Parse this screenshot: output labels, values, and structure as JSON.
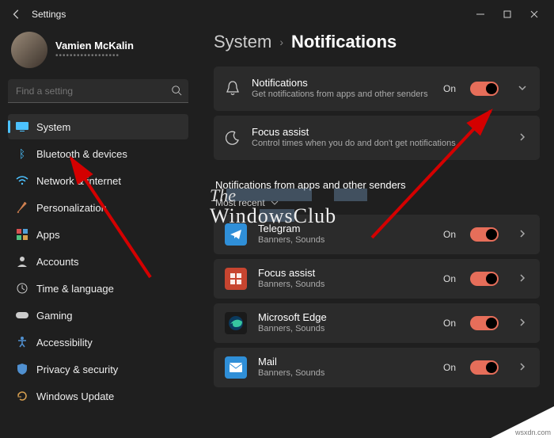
{
  "window": {
    "title": "Settings"
  },
  "user": {
    "name": "Vamien McKalin",
    "email": "••••••••••••••••••"
  },
  "search": {
    "placeholder": "Find a setting"
  },
  "sidebar": {
    "items": [
      {
        "icon": "system",
        "label": "System",
        "selected": true
      },
      {
        "icon": "bluetooth",
        "label": "Bluetooth & devices"
      },
      {
        "icon": "wifi",
        "label": "Network & internet"
      },
      {
        "icon": "brush",
        "label": "Personalization"
      },
      {
        "icon": "apps",
        "label": "Apps"
      },
      {
        "icon": "person",
        "label": "Accounts"
      },
      {
        "icon": "clock",
        "label": "Time & language"
      },
      {
        "icon": "game",
        "label": "Gaming"
      },
      {
        "icon": "access",
        "label": "Accessibility"
      },
      {
        "icon": "shield",
        "label": "Privacy & security"
      },
      {
        "icon": "update",
        "label": "Windows Update"
      }
    ]
  },
  "breadcrumb": {
    "parent": "System",
    "sep": "›",
    "current": "Notifications"
  },
  "cards": {
    "notifications": {
      "title": "Notifications",
      "sub": "Get notifications from apps and other senders",
      "state": "On"
    },
    "focus": {
      "title": "Focus assist",
      "sub": "Control times when you do and don't get notifications"
    }
  },
  "appsSection": {
    "title": "Notifications from apps and other senders",
    "sort": "Most recent"
  },
  "apps": [
    {
      "name": "Telegram",
      "sub": "Banners, Sounds",
      "state": "On",
      "iconClass": "ic-telegram"
    },
    {
      "name": "Focus assist",
      "sub": "Banners, Sounds",
      "state": "On",
      "iconClass": "ic-focus"
    },
    {
      "name": "Microsoft Edge",
      "sub": "Banners, Sounds",
      "state": "On",
      "iconClass": "ic-edge"
    },
    {
      "name": "Mail",
      "sub": "Banners, Sounds",
      "state": "On",
      "iconClass": "ic-mail"
    }
  ],
  "watermark": {
    "line1": "The",
    "line2": "WindowsClub"
  },
  "corner": "wsxdn.com",
  "colors": {
    "accent": "#e66e5a",
    "select": "#4cc2ff"
  }
}
